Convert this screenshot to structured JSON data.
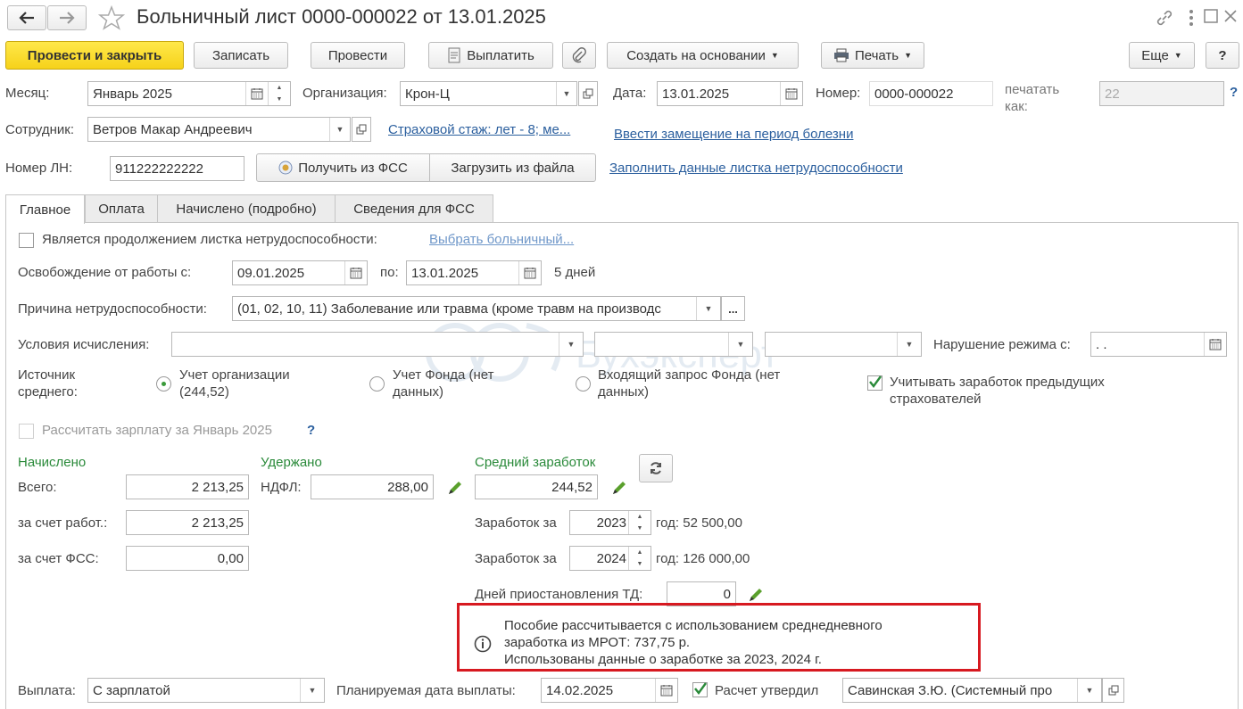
{
  "window": {
    "title": "Больничный лист 0000-000022 от 13.01.2025"
  },
  "toolbar": {
    "post_close": "Провести и закрыть",
    "save": "Записать",
    "post": "Провести",
    "pay": "Выплатить",
    "create_based": "Создать на основании",
    "print": "Печать",
    "more": "Еще",
    "help": "?"
  },
  "header": {
    "month_label": "Месяц:",
    "month_value": "Январь 2025",
    "org_label": "Организация:",
    "org_value": "Крон-Ц",
    "date_label": "Дата:",
    "date_value": "13.01.2025",
    "number_label": "Номер:",
    "number_value": "0000-000022",
    "print_as_label_1": "печатать",
    "print_as_label_2": "как:",
    "print_as_value": "22",
    "help_q": "?",
    "employee_label": "Сотрудник:",
    "employee_value": "Ветров Макар Андреевич",
    "insurance_link": "Страховой стаж: лет - 8; ме...",
    "replacement_link": "Ввести замещение на период болезни",
    "ln_label": "Номер ЛН:",
    "ln_value": "911222222222",
    "get_fss": "Получить из ФСС",
    "load_file": "Загрузить из файла",
    "fill_link": "Заполнить данные листка нетрудоспособности"
  },
  "tabs": [
    {
      "label": "Главное"
    },
    {
      "label": "Оплата"
    },
    {
      "label": "Начислено (подробно)"
    },
    {
      "label": "Сведения для ФСС"
    }
  ],
  "main": {
    "continuation_label": "Является продолжением листка нетрудоспособности:",
    "choose_link": "Выбрать больничный...",
    "release_label": "Освобождение от работы с:",
    "release_from": "09.01.2025",
    "to_label": "по:",
    "release_to": "13.01.2025",
    "days": "5 дней",
    "reason_label": "Причина нетрудоспособности:",
    "reason_value": "(01, 02, 10, 11) Заболевание или травма (кроме травм на производс",
    "more_btn": "...",
    "conditions_label": "Условия исчисления:",
    "violation_label": "Нарушение режима с:",
    "violation_value": " .  .",
    "source_label_1": "Источник",
    "source_label_2": "среднего:",
    "radio_org_1": "Учет организации",
    "radio_org_2": "(244,52)",
    "radio_fund_1": "Учет Фонда (нет",
    "radio_fund_2": "данных)",
    "radio_incoming_1": "Входящий запрос Фонда (нет",
    "radio_incoming_2": "данных)",
    "prev_insurers_1": "Учитывать заработок предыдущих",
    "prev_insurers_2": "страхователей",
    "recalc_label": "Рассчитать зарплату за Январь 2025",
    "recalc_q": "?",
    "accrued_head": "Начислено",
    "withheld_head": "Удержано",
    "avg_head": "Средний заработок",
    "total_label": "Всего:",
    "total_value": "2 213,25",
    "ndfl_label": "НДФЛ:",
    "ndfl_value": "288,00",
    "avg_value": "244,52",
    "employer_label": "за счет работ.:",
    "employer_value": "2 213,25",
    "fss_label": "за счет ФСС:",
    "fss_value": "0,00",
    "earn_label": "Заработок за",
    "year1": "2023",
    "year1_text": "год: 52 500,00",
    "year2": "2024",
    "year2_text": "год: 126 000,00",
    "suspension_label": "Дней приостановления ТД:",
    "suspension_value": "0",
    "info_1": "Пособие рассчитывается с использованием среднедневного",
    "info_2": "заработка из МРОТ: 737,75 р.",
    "info_3": "Использованы данные о заработке за  2023,  2024 г.",
    "watermark": "Бухэксперт"
  },
  "footer": {
    "payout_label": "Выплата:",
    "payout_value": "С зарплатой",
    "planned_label": "Планируемая дата выплаты:",
    "planned_value": "14.02.2025",
    "approved_label": "Расчет утвердил",
    "approved_value": "Савинская З.Ю. (Системный про"
  },
  "colors": {
    "primary_button": "#f6d21a",
    "link": "#2b5f9e",
    "section_green": "#2a8a3a",
    "highlight_border": "#d71920"
  }
}
